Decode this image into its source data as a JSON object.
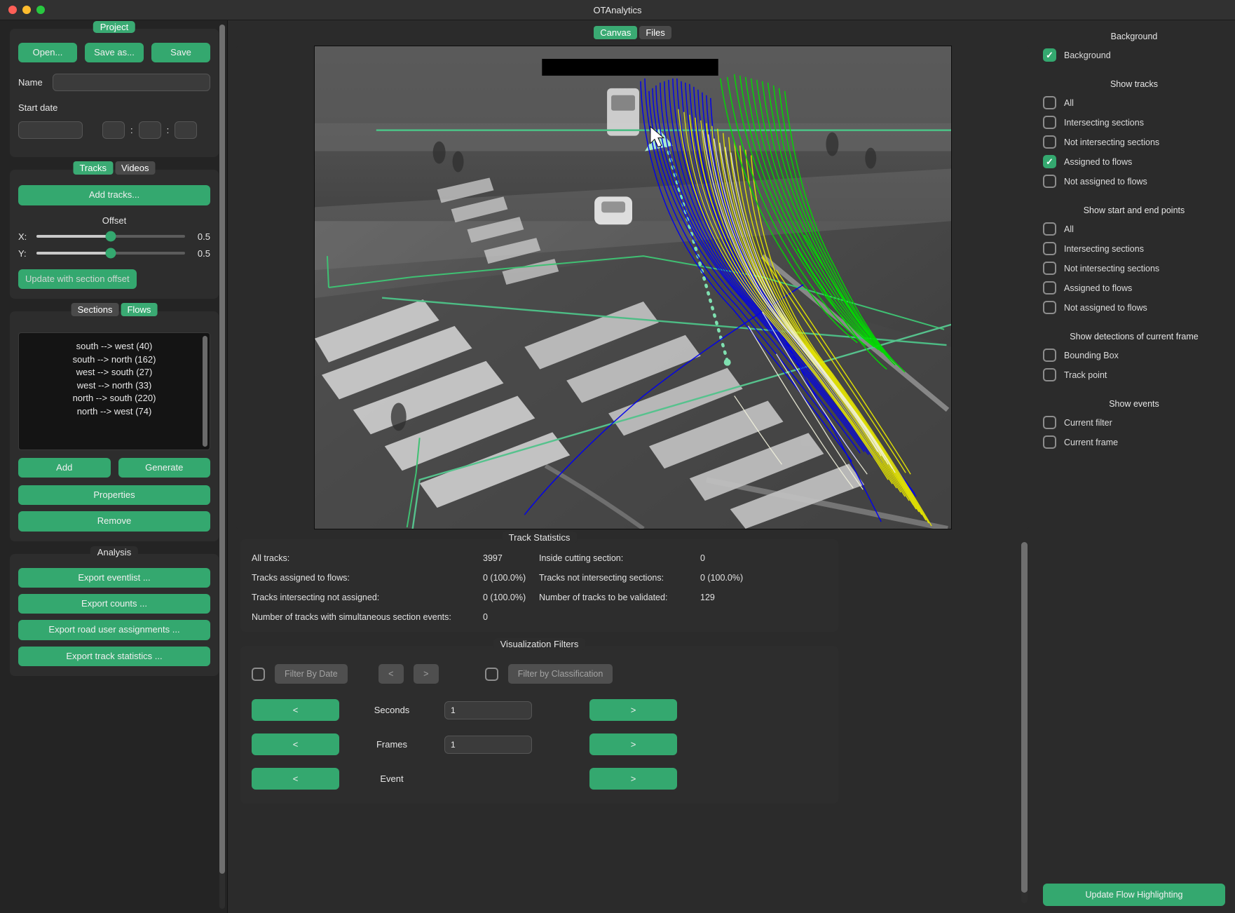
{
  "window": {
    "title": "OTAnalytics"
  },
  "project": {
    "title": "Project",
    "open_label": "Open...",
    "save_as_label": "Save as...",
    "save_label": "Save",
    "name_label": "Name",
    "name_value": "",
    "start_date_label": "Start date",
    "date_value": "",
    "hour_value": "",
    "minute_value": "",
    "second_value": "",
    "separator": ":"
  },
  "tracks": {
    "tab_tracks": "Tracks",
    "tab_videos": "Videos",
    "add_tracks_label": "Add tracks...",
    "offset_label": "Offset",
    "x_label": "X:",
    "y_label": "Y:",
    "x_value": "0.5",
    "y_value": "0.5",
    "update_offset_label": "Update with section offset"
  },
  "flows": {
    "tab_sections": "Sections",
    "tab_flows": "Flows",
    "items": [
      "south --> west (40)",
      "south --> north (162)",
      "west --> south (27)",
      "west --> north (33)",
      "north --> south (220)",
      "north --> west (74)"
    ],
    "add_label": "Add",
    "generate_label": "Generate",
    "properties_label": "Properties",
    "remove_label": "Remove"
  },
  "analysis": {
    "title": "Analysis",
    "buttons": [
      "Export eventlist ...",
      "Export counts ...",
      "Export road user assignments ...",
      "Export track statistics ..."
    ]
  },
  "canvas": {
    "tab_canvas": "Canvas",
    "tab_files": "Files"
  },
  "statistics": {
    "title": "Track Statistics",
    "rows": [
      {
        "key": "All tracks:",
        "value": "3997",
        "key2": "Inside cutting section:",
        "value2": "0"
      },
      {
        "key": "Tracks assigned to flows:",
        "value": "0 (100.0%)",
        "key2": "Tracks not intersecting sections:",
        "value2": "0 (100.0%)"
      },
      {
        "key": "Tracks intersecting not assigned:",
        "value": "0 (100.0%)",
        "key2": "Number of tracks to be validated:",
        "value2": "129"
      }
    ],
    "simultaneous_key": "Number of tracks with simultaneous section events:",
    "simultaneous_value": "0"
  },
  "filters": {
    "title": "Visualization Filters",
    "filter_by_date_label": "Filter By Date",
    "prev_small_label": "<",
    "next_small_label": ">",
    "filter_by_classification_label": "Filter by Classification",
    "seconds_label": "Seconds",
    "seconds_value": "1",
    "frames_label": "Frames",
    "frames_value": "1",
    "event_label": "Event",
    "prev_label": "<",
    "next_label": ">"
  },
  "visualization": {
    "background_title": "Background",
    "background_label": "Background",
    "background_checked": true,
    "show_tracks_title": "Show tracks",
    "show_tracks": [
      {
        "label": "All",
        "checked": false
      },
      {
        "label": "Intersecting sections",
        "checked": false
      },
      {
        "label": "Not intersecting sections",
        "checked": false
      },
      {
        "label": "Assigned to flows",
        "checked": true
      },
      {
        "label": "Not assigned to flows",
        "checked": false
      }
    ],
    "start_end_title": "Show start and end points",
    "start_end": [
      {
        "label": "All",
        "checked": false
      },
      {
        "label": "Intersecting sections",
        "checked": false
      },
      {
        "label": "Not intersecting sections",
        "checked": false
      },
      {
        "label": "Assigned to flows",
        "checked": false
      },
      {
        "label": "Not assigned to flows",
        "checked": false
      }
    ],
    "detections_title": "Show detections of current frame",
    "detections": [
      {
        "label": "Bounding Box",
        "checked": false
      },
      {
        "label": "Track point",
        "checked": false
      }
    ],
    "events_title": "Show events",
    "events": [
      {
        "label": "Current filter",
        "checked": false
      },
      {
        "label": "Current frame",
        "checked": false
      }
    ],
    "update_flow_label": "Update Flow Highlighting"
  },
  "colors": {
    "accent": "#34a86f",
    "panel": "#2d2d2d",
    "background": "#2b2b2b",
    "track_blue": "#0000ee",
    "track_green": "#00dd00",
    "track_yellow": "#e6e600",
    "track_white": "#f0f0e0",
    "section_green": "#44bb77"
  }
}
